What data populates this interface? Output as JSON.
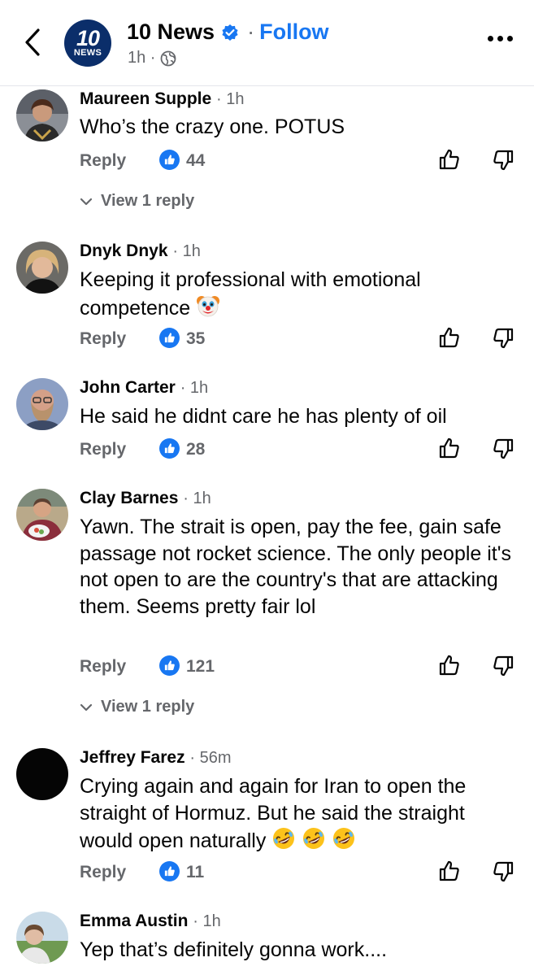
{
  "header": {
    "page_name": "10 News",
    "separator": "·",
    "follow_label": "Follow",
    "post_time": "1h ·",
    "logo_number": "10",
    "logo_text": "NEWS"
  },
  "comments": [
    {
      "name": "Maureen Supple",
      "time": "· 1h",
      "text": "Who’s the crazy one. POTUS",
      "reply_label": "Reply",
      "likes": "44",
      "view_replies": "View 1 reply"
    },
    {
      "name": "Dnyk Dnyk",
      "time": "· 1h",
      "text": "Keeping it professional with emotional competence",
      "reply_label": "Reply",
      "likes": "35"
    },
    {
      "name": "John Carter",
      "time": "· 1h",
      "text": "He said he didnt care he has plenty of oil",
      "reply_label": "Reply",
      "likes": "28"
    },
    {
      "name": "Clay Barnes",
      "time": "· 1h",
      "text": "Yawn. The strait is open, pay the fee, gain safe passage not rocket science. The only people it's not open to are the country's that are attacking them. Seems pretty fair lol",
      "reply_label": "Reply",
      "likes": "121",
      "view_replies": "View 1 reply"
    },
    {
      "name": "Jeffrey Farez",
      "time": "· 56m",
      "text": "Crying again and again for Iran to open the straight of Hormuz. But he said the straight would open naturally",
      "reply_label": "Reply",
      "likes": "11"
    },
    {
      "name": "Emma Austin",
      "time": "· 1h",
      "text": "Yep that’s definitely gonna work...."
    }
  ],
  "icons": {
    "back": "chevron-left-icon",
    "verified": "verified-badge-icon",
    "globe": "globe-icon",
    "more": "more-options-icon",
    "like_badge": "like-badge-icon",
    "thumb_up": "thumb-up-icon",
    "thumb_down": "thumb-down-icon",
    "emoji_clown": "clown-face-emoji",
    "emoji_rofl": "rolling-on-floor-laughing-emoji"
  },
  "colors": {
    "accent": "#1877f2",
    "secondary_text": "#65676b",
    "primary_text": "#050505",
    "logo_bg": "#0b2e6a"
  }
}
